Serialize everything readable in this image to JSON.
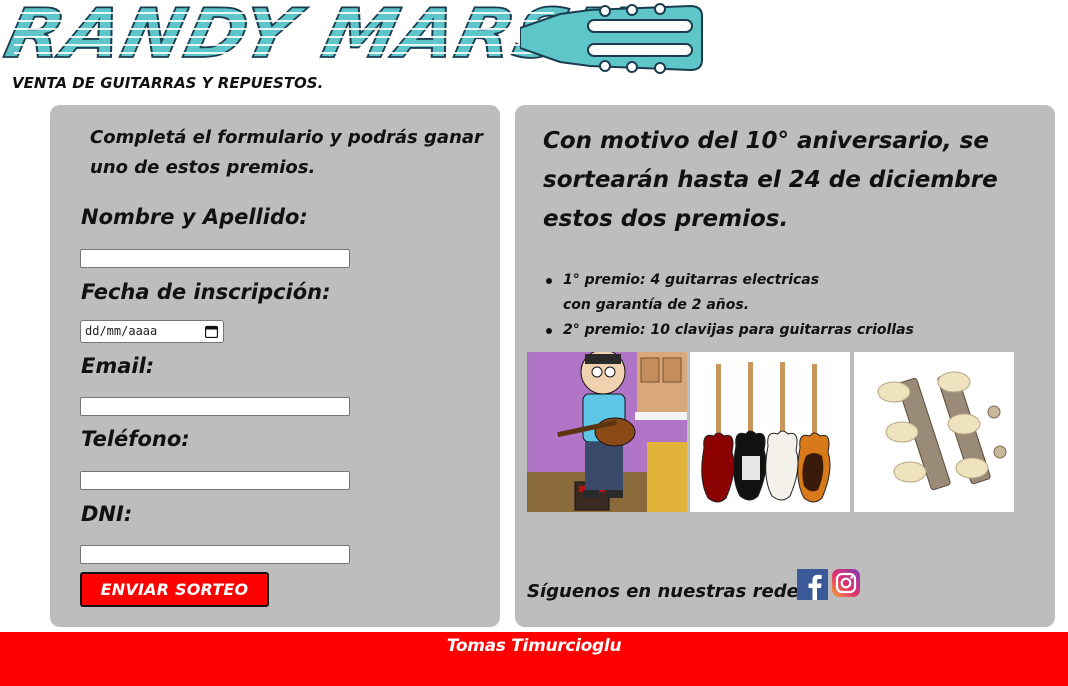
{
  "brand": {
    "title": "RANDY MARSH",
    "subtitle": "VENTA DE GUITARRAS Y REPUESTOS.",
    "colors": {
      "logo": "#5ec6c9",
      "outline": "#1b3d4f"
    }
  },
  "form": {
    "intro": "Completá el formulario y podrás ganar uno de estos premios.",
    "fields": {
      "name": {
        "label": "Nombre y Apellido:"
      },
      "date": {
        "label": "Fecha de inscripción:",
        "placeholder": "dd/mm/aaaa"
      },
      "email": {
        "label": "Email:"
      },
      "phone": {
        "label": "Teléfono:"
      },
      "dni": {
        "label": "DNI:"
      }
    },
    "submit_label": "ENVIAR SORTEO"
  },
  "promo": {
    "headline": "Con motivo del 10° aniversario, se sortearán hasta el 24 de diciembre estos dos premios.",
    "prizes": [
      {
        "line1": "1° premio: 4 guitarras electricas",
        "line2": "con garantía de 2 años."
      },
      {
        "line1": "2° premio: 10 clavijas para guitarras criollas"
      }
    ],
    "follow_text": "Síguenos en nuestras redes:",
    "social": [
      "facebook-icon",
      "instagram-icon"
    ]
  },
  "footer": {
    "name": "Tomas Timurcioglu"
  },
  "colors": {
    "panel": "#bdbdbd",
    "accent": "#ff0000",
    "facebook": "#3b5998"
  }
}
